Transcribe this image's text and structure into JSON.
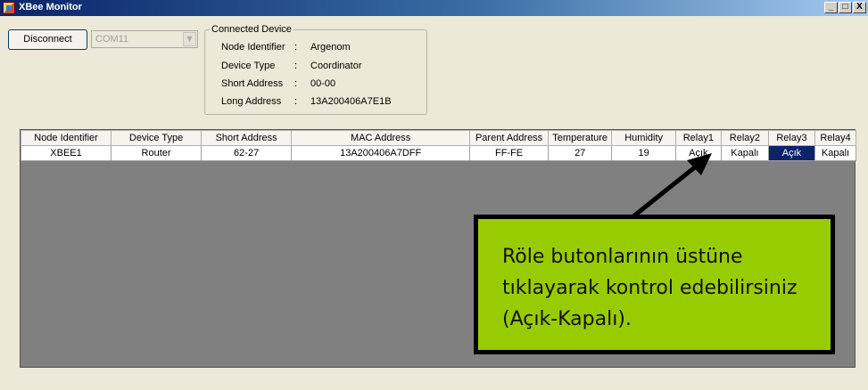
{
  "window": {
    "title": "XBee Monitor",
    "buttons": {
      "minimize": "_",
      "maximize": "□",
      "close": "X"
    }
  },
  "controls": {
    "disconnect_label": "Disconnect",
    "port_value": "COM11"
  },
  "connected_device": {
    "legend": "Connected Device",
    "rows": [
      {
        "label": "Node Identifier",
        "colon": ":",
        "value": "Argenom"
      },
      {
        "label": "Device Type",
        "colon": ":",
        "value": "Coordinator"
      },
      {
        "label": "Short Address",
        "colon": ":",
        "value": "00-00"
      },
      {
        "label": "Long Address",
        "colon": ":",
        "value": "13A200406A7E1B"
      }
    ]
  },
  "grid": {
    "headers": [
      "Node Identifier",
      "Device Type",
      "Short Address",
      "MAC Address",
      "Parent Address",
      "Temperature",
      "Humidity",
      "Relay1",
      "Relay2",
      "Relay3",
      "Relay4"
    ],
    "rows": [
      [
        "XBEE1",
        "Router",
        "62-27",
        "13A200406A7DFF",
        "FF-FE",
        "27",
        "19",
        "Açık",
        "Kapalı",
        "Açık",
        "Kapalı"
      ]
    ]
  },
  "callout": {
    "text": "Röle butonlarının üstüne tıklayarak kontrol edebilirsiniz (Açık-Kapalı)."
  },
  "colors": {
    "callout_bg": "#99cc00",
    "selected_cell": "#0a246a"
  }
}
